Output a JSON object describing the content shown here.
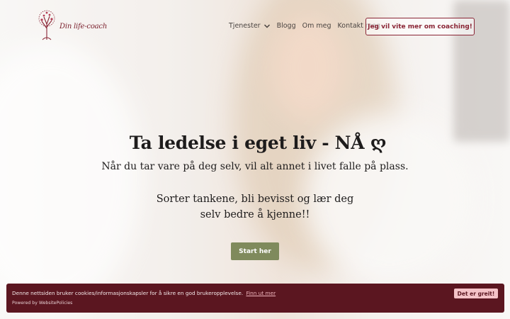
{
  "brand": {
    "logo_text": "Din life-coach",
    "accent": "#8a2535"
  },
  "nav": {
    "items": [
      {
        "label": "Tjenester",
        "has_dropdown": true
      },
      {
        "label": "Blogg"
      },
      {
        "label": "Om meg"
      },
      {
        "label": "Kontakt meg"
      }
    ],
    "cta_label": "Jeg vil vite mer om coaching!"
  },
  "hero": {
    "headline": "Ta ledelse i eget liv - NÅ ღ",
    "subline": "Når du tar vare på deg selv, vil alt annet i livet falle på plass.",
    "body_line1": "Sorter tankene, bli bevisst og lær deg",
    "body_line2": "selv bedre å kjenne!!",
    "button_label": "Start her",
    "button_color": "#7f8a5c"
  },
  "cookie_banner": {
    "text": "Denne nettsiden bruker cookies/informasjonskapsler for å sikre en god brukeropplevelse.",
    "link_label": "Finn ut mer",
    "powered_by": "Powered by WebsitePolicies",
    "accept_label": "Det er greit!",
    "background": "#5b1620"
  }
}
